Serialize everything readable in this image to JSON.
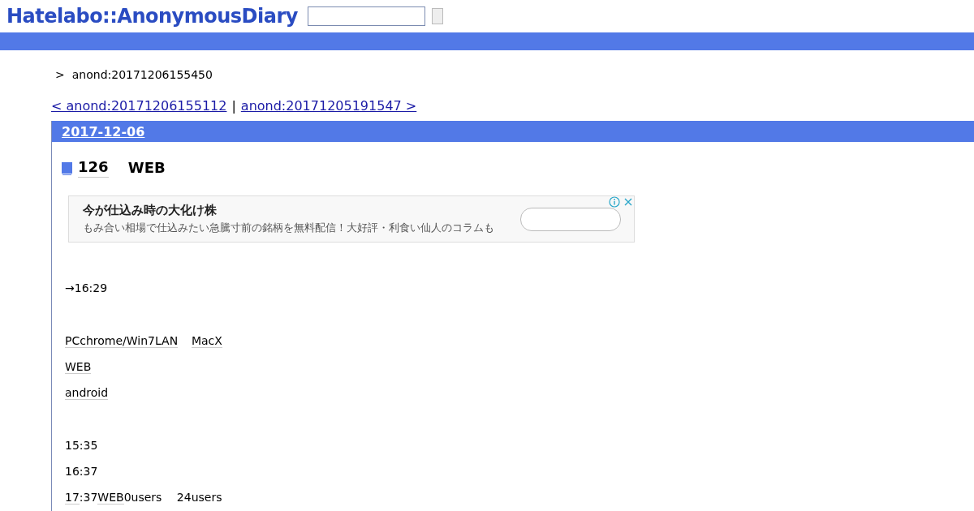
{
  "header": {
    "logo": "Hatelabo::AnonymousDiary",
    "search": {
      "kind": "field"
    }
  },
  "breadcrumb": {
    "separator": ">",
    "current": "anond:20171206155450"
  },
  "pager": {
    "prev": "< anond:20171206155112",
    "divider": "|",
    "next": "anond:20171205191547 >"
  },
  "day": {
    "date": "2017-12-06",
    "title": [
      {
        "text": "126",
        "keyword": true
      },
      {
        "text": "　 WEB",
        "keyword": false
      }
    ],
    "ad": {
      "headline": "今が仕込み時の大化け株",
      "description": "もみ合い相場で仕込みたい急騰寸前の銘柄を無料配信！大好評・利食い仙人のコラムも"
    },
    "blocks": [
      [
        [
          {
            "text": "→16:29",
            "keyword": false
          }
        ]
      ],
      [
        [
          {
            "text": "PCchrome/Win7LAN",
            "keyword": true
          },
          {
            "text": "MacX",
            "keyword": true
          }
        ],
        [
          {
            "text": "WEB",
            "keyword": true
          }
        ],
        [
          {
            "text": "android",
            "keyword": true
          }
        ]
      ],
      [
        [
          {
            "text": "15:35",
            "keyword": false
          }
        ],
        [
          {
            "text": "16:37",
            "keyword": false
          }
        ],
        [
          {
            "text": "17",
            "keyword": true
          },
          {
            "text": ":37",
            "keyword": false
          },
          {
            "text": "WEB",
            "keyword": true
          },
          {
            "text": "0users　 24users",
            "keyword": false
          }
        ]
      ]
    ]
  }
}
